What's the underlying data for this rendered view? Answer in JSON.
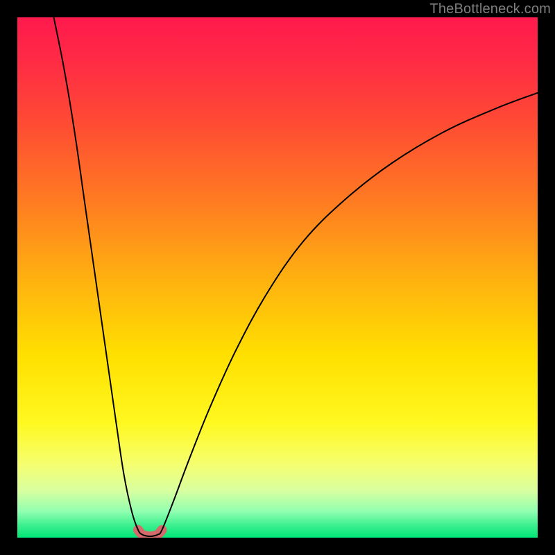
{
  "watermark": "TheBottleneck.com",
  "colors": {
    "frame": "#000000",
    "curve": "#000000",
    "dip_highlight": "#d46a6a",
    "gradient_stops": [
      {
        "offset": 0.0,
        "color": "#ff1a4d"
      },
      {
        "offset": 0.08,
        "color": "#ff2a45"
      },
      {
        "offset": 0.2,
        "color": "#ff4a34"
      },
      {
        "offset": 0.35,
        "color": "#ff7a22"
      },
      {
        "offset": 0.5,
        "color": "#ffb010"
      },
      {
        "offset": 0.65,
        "color": "#ffe000"
      },
      {
        "offset": 0.78,
        "color": "#fff820"
      },
      {
        "offset": 0.86,
        "color": "#f5ff70"
      },
      {
        "offset": 0.91,
        "color": "#d8ffa0"
      },
      {
        "offset": 0.95,
        "color": "#90ffb0"
      },
      {
        "offset": 0.975,
        "color": "#40f090"
      },
      {
        "offset": 1.0,
        "color": "#00e676"
      }
    ]
  },
  "chart_data": {
    "type": "line",
    "title": "",
    "xlabel": "",
    "ylabel": "",
    "xlim": [
      0,
      100
    ],
    "ylim": [
      0,
      100
    ],
    "grid": false,
    "series": [
      {
        "name": "left-branch",
        "x": [
          7,
          9,
          11,
          13,
          15,
          17,
          19,
          20.5,
          22,
          23.2
        ],
        "y": [
          100,
          90,
          78,
          64,
          50,
          36,
          22,
          12,
          5,
          1.5
        ]
      },
      {
        "name": "dip",
        "x": [
          23.2,
          24.0,
          25.0,
          26.0,
          27.0,
          27.8
        ],
        "y": [
          1.5,
          0.6,
          0.3,
          0.3,
          0.6,
          1.5
        ]
      },
      {
        "name": "right-branch",
        "x": [
          27.8,
          30,
          33,
          37,
          42,
          48,
          55,
          63,
          72,
          82,
          92,
          100
        ],
        "y": [
          1.5,
          7,
          15,
          25,
          36,
          47,
          57,
          65,
          72,
          78,
          82.5,
          85.5
        ]
      }
    ],
    "highlight": {
      "name": "dip-highlight",
      "x": [
        23.2,
        24.0,
        25.0,
        26.0,
        27.0,
        27.8
      ],
      "y": [
        1.5,
        0.6,
        0.3,
        0.3,
        0.6,
        1.5
      ],
      "stroke_width_px": 14
    }
  }
}
